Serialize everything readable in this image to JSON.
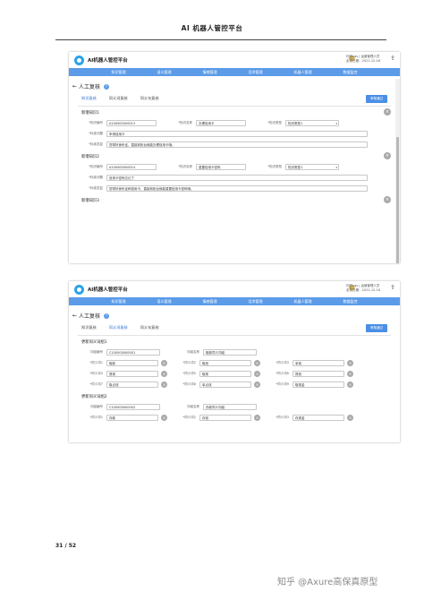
{
  "doc_title": "AI 机器人管控平台",
  "app": {
    "name": "AI机器人管控平台",
    "user_line1": "何欣sqs | 运营管理人员",
    "user_line2": "走访日期：2021-12-16",
    "nav": [
      "知识管理",
      "语义管理",
      "情感管理",
      "话术管理",
      "机器人管理",
      "数据监控"
    ],
    "page_title": "人工复核",
    "tabs": [
      "知识复核",
      "同义词复核",
      "同义句复核"
    ],
    "submit_button": "审核通过"
  },
  "screen1": {
    "active_tab": 0,
    "sections": [
      {
        "title": "新增知识1",
        "id_label": "*知识编号",
        "id_value": "A100000000013",
        "name_label": "*知识名称",
        "name_value": "办理信用卡",
        "type_label": "*知识类型",
        "type_value": "知识类型1",
        "q_label": "*标准问题",
        "q_value": "申请信用卡",
        "a_label": "*标准答复",
        "a_value": "您带好身份证，直接到柜台就能办理信用卡哦。"
      },
      {
        "title": "新增知识2",
        "id_label": "*知识编号",
        "id_value": "A100000000014",
        "name_label": "*知识名称",
        "name_value": "重置信用卡密码",
        "type_label": "*知识类型",
        "type_value": "知识类型1",
        "q_label": "*标准问题",
        "q_value": "信用卡密码忘记了",
        "a_label": "*标准答复",
        "a_value": "您带好身份证和信用卡，直接到柜台就能重置信用卡密码哦。"
      }
    ],
    "partial_section": "新增知识3"
  },
  "screen2": {
    "active_tab": 1,
    "groups": [
      {
        "title": "更新同义词组1",
        "id_label": "词组编号",
        "id_value": "C100000000001",
        "name_label": "词组名称",
        "name_value": "取款同义词组",
        "rows": [
          [
            {
              "label": "*同义词1",
              "value": "取款"
            },
            {
              "label": "*同义词2",
              "value": "取钱"
            },
            {
              "label": "*同义词3",
              "value": "拿钱"
            }
          ],
          [
            {
              "label": "*同义词4",
              "value": "提现"
            },
            {
              "label": "*同义词5",
              "value": "取现"
            },
            {
              "label": "*同义词6",
              "value": "提钱"
            }
          ],
          [
            {
              "label": "*同义词7",
              "value": "取点钱"
            },
            {
              "label": "*同义词8",
              "value": "拿点钱"
            },
            {
              "label": "*同义词9",
              "value": "取现金"
            }
          ]
        ]
      },
      {
        "title": "更新同义词组2",
        "id_label": "词组编号",
        "id_value": "C100000000002",
        "name_label": "词组名称",
        "name_value": "存款同义词组",
        "rows": [
          [
            {
              "label": "*同义词1",
              "value": "存款"
            },
            {
              "label": "*同义词2",
              "value": "存钱"
            },
            {
              "label": "*同义词3",
              "value": "存现金"
            }
          ]
        ]
      }
    ]
  },
  "page_number": "31 / 52",
  "watermark": "知乎 @Axure高保真原型"
}
